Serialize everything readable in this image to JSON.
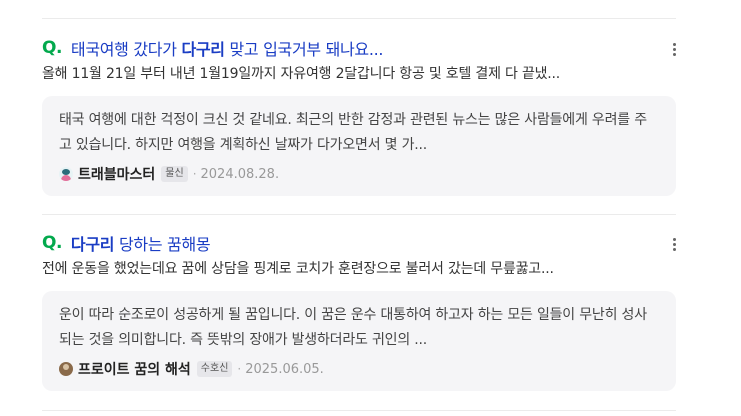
{
  "results": [
    {
      "icon": "Q.",
      "title_pre": "태국여행 갔다가 ",
      "title_keyword": "다구리",
      "title_post": " 맞고 입국거부 돼나요...",
      "snippet": "올해 11월 21일 부터 내년 1월19일까지 자유여행 2달갑니다 항공 및 호텔 결제 다 끝냈...",
      "answer": "태국 여행에 대한 걱정이 크신 것 같네요. 최근의 반한 감정과 관련된 뉴스는 많은 사람들에게 우려를 주고 있습니다. 하지만 여행을 계획하신 날짜가 다가오면서 몇 가...",
      "author": "트래블마스터",
      "badge": "물신",
      "date": "2024.08.28."
    },
    {
      "icon": "Q.",
      "title_pre": "",
      "title_keyword": "다구리",
      "title_post": " 당하는 꿈해몽",
      "snippet": "전에 운동을 했었는데요 꿈에 상담을 핑계로 코치가 훈련장으로 불러서 갔는데 무릎꿇고...",
      "answer": "운이 따라 순조로이 성공하게 될 꿈입니다. 이 꿈은 운수 대통하여 하고자 하는 모든 일들이 무난히 성사되는 것을 의미합니다. 즉 뜻밖의 장애가 발생하더라도 귀인의 ...",
      "author": "프로이트 꿈의 해석",
      "badge": "수호신",
      "date": "2025.06.05."
    }
  ],
  "separator": "·",
  "colors": {
    "title_link": "#1a3dc4",
    "q_icon": "#03a94d",
    "answer_bg": "#f5f5f7"
  },
  "icons": {
    "question": "question-mark-icon",
    "more": "more-options-icon"
  }
}
